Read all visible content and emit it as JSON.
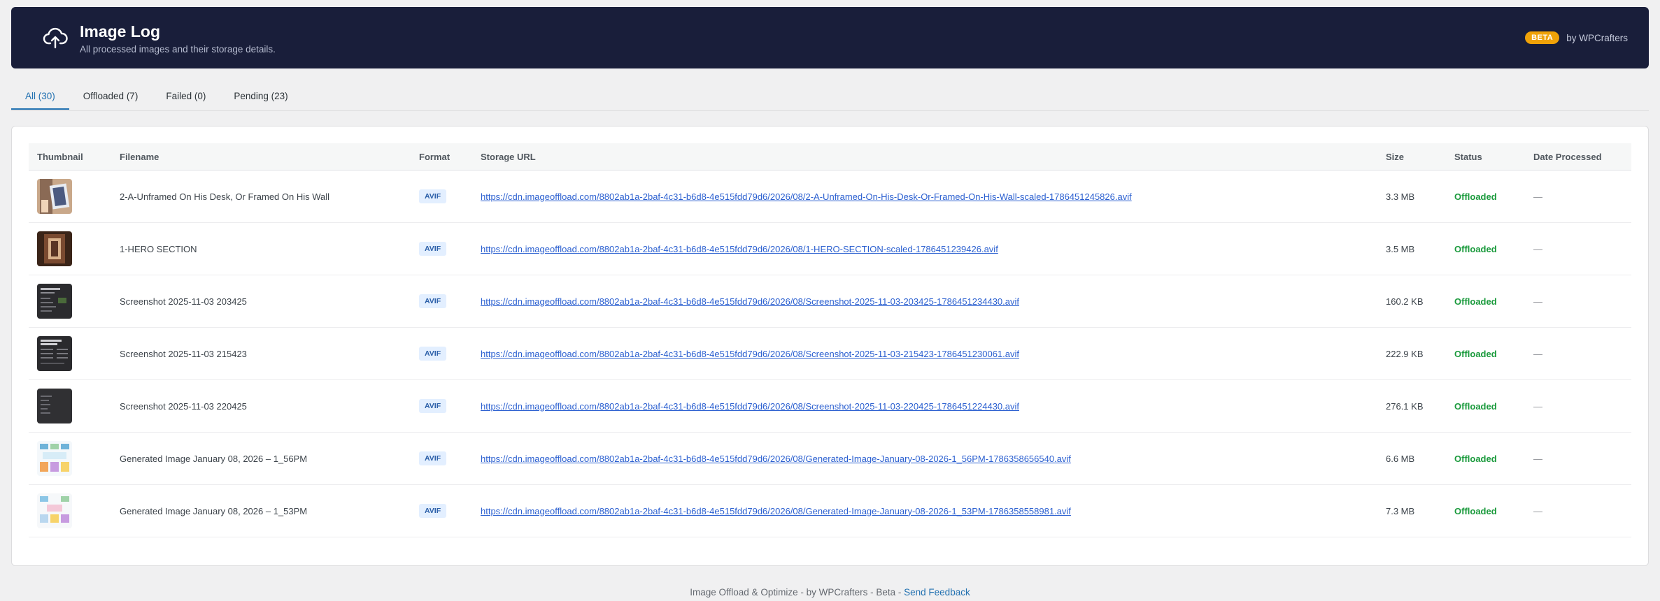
{
  "header": {
    "title": "Image Log",
    "subtitle": "All processed images and their storage details.",
    "badge": "BETA",
    "by": "by WPCrafters"
  },
  "tabs": [
    {
      "label": "All (30)",
      "active": true
    },
    {
      "label": "Offloaded (7)",
      "active": false
    },
    {
      "label": "Failed (0)",
      "active": false
    },
    {
      "label": "Pending (23)",
      "active": false
    }
  ],
  "table": {
    "columns": [
      "Thumbnail",
      "Filename",
      "Format",
      "Storage URL",
      "Size",
      "Status",
      "Date Processed"
    ],
    "rows": [
      {
        "filename": "2-A-Unframed On His Desk, Or Framed On His Wall",
        "format": "AVIF",
        "url": "https://cdn.imageoffload.com/8802ab1a-2baf-4c31-b6d8-4e515fdd79d6/2026/08/2-A-Unframed-On-His-Desk-Or-Framed-On-His-Wall-scaled-1786451245826.avif",
        "size": "3.3 MB",
        "status": "Offloaded",
        "date": "—"
      },
      {
        "filename": "1-HERO SECTION",
        "format": "AVIF",
        "url": "https://cdn.imageoffload.com/8802ab1a-2baf-4c31-b6d8-4e515fdd79d6/2026/08/1-HERO-SECTION-scaled-1786451239426.avif",
        "size": "3.5 MB",
        "status": "Offloaded",
        "date": "—"
      },
      {
        "filename": "Screenshot 2025-11-03 203425",
        "format": "AVIF",
        "url": "https://cdn.imageoffload.com/8802ab1a-2baf-4c31-b6d8-4e515fdd79d6/2026/08/Screenshot-2025-11-03-203425-1786451234430.avif",
        "size": "160.2 KB",
        "status": "Offloaded",
        "date": "—"
      },
      {
        "filename": "Screenshot 2025-11-03 215423",
        "format": "AVIF",
        "url": "https://cdn.imageoffload.com/8802ab1a-2baf-4c31-b6d8-4e515fdd79d6/2026/08/Screenshot-2025-11-03-215423-1786451230061.avif",
        "size": "222.9 KB",
        "status": "Offloaded",
        "date": "—"
      },
      {
        "filename": "Screenshot 2025-11-03 220425",
        "format": "AVIF",
        "url": "https://cdn.imageoffload.com/8802ab1a-2baf-4c31-b6d8-4e515fdd79d6/2026/08/Screenshot-2025-11-03-220425-1786451224430.avif",
        "size": "276.1 KB",
        "status": "Offloaded",
        "date": "—"
      },
      {
        "filename": "Generated Image January 08, 2026 – 1_56PM",
        "format": "AVIF",
        "url": "https://cdn.imageoffload.com/8802ab1a-2baf-4c31-b6d8-4e515fdd79d6/2026/08/Generated-Image-January-08-2026-1_56PM-1786358656540.avif",
        "size": "6.6 MB",
        "status": "Offloaded",
        "date": "—"
      },
      {
        "filename": "Generated Image January 08, 2026 – 1_53PM",
        "format": "AVIF",
        "url": "https://cdn.imageoffload.com/8802ab1a-2baf-4c31-b6d8-4e515fdd79d6/2026/08/Generated-Image-January-08-2026-1_53PM-1786358558981.avif",
        "size": "7.3 MB",
        "status": "Offloaded",
        "date": "—"
      }
    ]
  },
  "footer": {
    "text": "Image Offload & Optimize - by WPCrafters - Beta -",
    "link": "Send Feedback"
  },
  "colors": {
    "banner_bg": "#191e3a",
    "badge": "#f0a208",
    "active_tab": "#2271b1",
    "status_offloaded": "#1a9a3c",
    "link": "#2a5fd0"
  }
}
